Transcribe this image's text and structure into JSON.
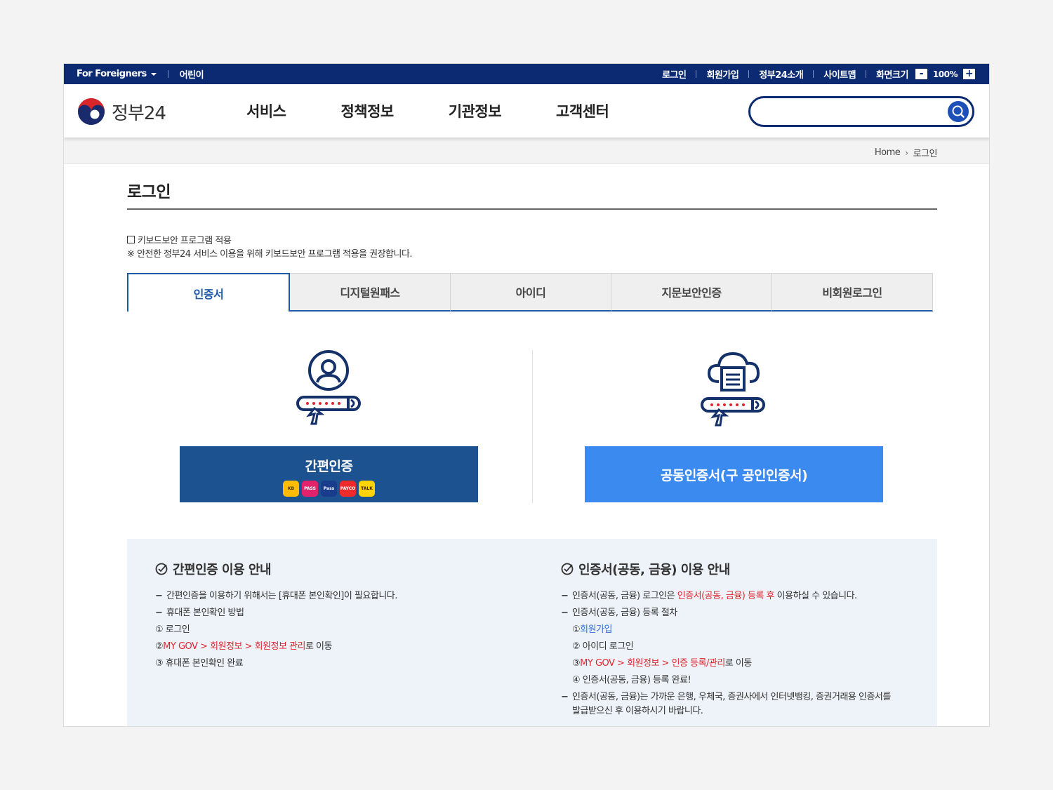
{
  "utilbar": {
    "foreigners": "For Foreigners",
    "kids": "어린이",
    "links": [
      "로그인",
      "회원가입",
      "정부24소개",
      "사이트맵"
    ],
    "zoom_label": "화면크기",
    "zoom_minus": "-",
    "zoom_value": "100%",
    "zoom_plus": "+"
  },
  "header": {
    "logo_text": "정부24",
    "nav": [
      "서비스",
      "정책정보",
      "기관정보",
      "고객센터"
    ],
    "search_placeholder": ""
  },
  "breadcrumb": {
    "home": "Home",
    "current": "로그인"
  },
  "page": {
    "title": "로그인",
    "keyboard_security": "키보드보안 프로그램 적용",
    "keyboard_note": "※ 안전한 정부24 서비스 이용을 위해 키보드보안 프로그램 적용을 권장합니다."
  },
  "tabs": [
    "인증서",
    "디지털원패스",
    "아이디",
    "지문보안인증",
    "비회원로그인"
  ],
  "login": {
    "simple_label": "간편인증",
    "simple_providers": [
      {
        "name": "kb",
        "text": "KB",
        "bg": "#ffbc00",
        "fg": "#333"
      },
      {
        "name": "pass-red",
        "text": "PASS",
        "bg": "#e3226e",
        "fg": "#fff"
      },
      {
        "name": "pass-blue",
        "text": "Pass",
        "bg": "#1a3c8c",
        "fg": "#fff"
      },
      {
        "name": "payco",
        "text": "PAYCO",
        "bg": "#ee2a2a",
        "fg": "#fff"
      },
      {
        "name": "kakao",
        "text": "TALK",
        "bg": "#ffd400",
        "fg": "#3a1d1d"
      }
    ],
    "cert_label": "공동인증서(구 공인인증서)"
  },
  "info": {
    "left": {
      "title": "간편인증 이용 안내",
      "line1": "간편인증을 이용하기 위해서는 [휴대폰 본인확인]이 필요합니다.",
      "line2": "휴대폰 본인확인 방법",
      "step1": "① 로그인",
      "step2_prefix": "② ",
      "step2_red": "MY GOV > 회원정보 > 회원정보 관리",
      "step2_suffix": "로 이동",
      "step3": "③ 휴대폰 본인확인 완료"
    },
    "right": {
      "title": "인증서(공동, 금융) 이용 안내",
      "line1_a": "인증서(공동, 금융) 로그인은 ",
      "line1_red": "인증서(공동, 금융) 등록 후",
      "line1_b": " 이용하실 수 있습니다.",
      "line2": "인증서(공동, 금융) 등록 절차",
      "step1_prefix": "① ",
      "step1_blue": "회원가입",
      "step2": "② 아이디 로그인",
      "step3_prefix": "③ ",
      "step3_red": "MY GOV > 회원정보 > 인증 등록/관리",
      "step3_suffix": "로 이동",
      "step4": "④ 인증서(공동, 금융) 등록 완료!",
      "line3": "인증서(공동, 금융)는 가까운 은행, 우체국, 증권사에서 인터넷뱅킹, 증권거래용 인증서를",
      "line3b": "발급받으신 후 이용하시기 바랍니다."
    }
  },
  "colors": {
    "navy": "#0b2a72",
    "tab_active": "#1f5aa8",
    "simple_btn": "#1c5290",
    "cert_btn": "#3b8af0",
    "info_bg": "#eef3f9",
    "accent_red": "#e0262f"
  }
}
